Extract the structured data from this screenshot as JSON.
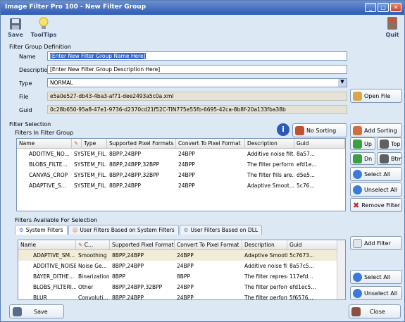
{
  "window": {
    "title": "Image Filter Pro 100 - New Filter Group",
    "btn_min": "_",
    "btn_max": "□",
    "btn_close": "✕"
  },
  "toolbar": {
    "save": "Save",
    "tooltips": "ToolTips",
    "quit": "Quit"
  },
  "definition": {
    "section": "Filter Group Definition",
    "name_label": "Name",
    "name_value": "[Enter New Filter Group Name Here]",
    "desc_label": "Description",
    "desc_value": "[Enter New Filter Group Description Here]",
    "type_label": "Type",
    "type_value": "NORMAL",
    "file_label": "File",
    "file_value": "e5a0e527-db43-4ba3-af71-dee2493a5c0a.xml",
    "guid_label": "Guid",
    "guid_value": "0c28b650-95a8-47e1-9736-d2370cd21f52C-TIN775e55fb-6695-42ca-8b8f-20a133fba38b",
    "open_file": "Open File"
  },
  "selection": {
    "section": "Filter Selection",
    "subsection": "Filters In Filter Group",
    "no_sorting": "No Sorting",
    "add_sorting": "Add Sorting",
    "up": "Up",
    "top": "Top",
    "dn": "Dn",
    "btm": "Btm",
    "select_all": "Select All",
    "unselect_all": "Unselect All",
    "remove": "Remove Filter",
    "headers": [
      "Name",
      "",
      "Type",
      "Supported Pixel Formats",
      "Convert To Pixel Format",
      "Description",
      "Guid"
    ],
    "rows": [
      [
        "ADDITIVE_NO...",
        "SYSTEM_FIL...",
        "8BPP,24BPP",
        "24BPP",
        "Additive noise filt...",
        "8a57..."
      ],
      [
        "BLOBS_FILTE...",
        "SYSTEM_FIL...",
        "8BPP,24BPP,32BPP",
        "24BPP",
        "The filter perform...",
        "efd1e..."
      ],
      [
        "CANVAS_CROP",
        "SYSTEM_FIL...",
        "8BPP,24BPP,32BPP",
        "24BPP",
        "The filter fills are...",
        "d5e5..."
      ],
      [
        "ADAPTIVE_S...",
        "SYSTEM_FIL...",
        "8BPP,24BPP",
        "24BPP",
        "Adaptive Smoot...",
        "5c76..."
      ]
    ]
  },
  "available": {
    "section": "Filters Available For Selection",
    "tabs": [
      "System Filters",
      "User Filters Based on System Filters",
      "User Filters Based on DLL"
    ],
    "add_filter": "Add Filter",
    "select_all": "Select All",
    "unselect_all": "Unselect All",
    "headers": [
      "Name",
      "C...",
      "Supported Pixel Formats",
      "Convert To Pixel Format",
      "Description",
      "Guid"
    ],
    "rows": [
      [
        "ADAPTIVE_SM...",
        "Smoothing",
        "8BPP,24BPP",
        "24BPP",
        "Adaptive Smoothi...",
        "5c7673..."
      ],
      [
        "ADDITIVE_NOISE",
        "Noise Ge...",
        "8BPP,24BPP",
        "24BPP",
        "Additive noise filte...",
        "8a57c5..."
      ],
      [
        "BAYER_DITHE...",
        "Binarization",
        "8BPP",
        "8BPP",
        "The filter represen...",
        "117efd..."
      ],
      [
        "BLOBS_FILTERI...",
        "Other",
        "8BPP,24BPP,32BPP",
        "24BPP",
        "The filter performs...",
        "efd1ec5..."
      ],
      [
        "BLUR",
        "Convoluti...",
        "8BPP,24BPP",
        "24BPP",
        "The filter performs",
        "5f6576..."
      ]
    ]
  },
  "footer": {
    "save": "Save",
    "close": "Close"
  }
}
